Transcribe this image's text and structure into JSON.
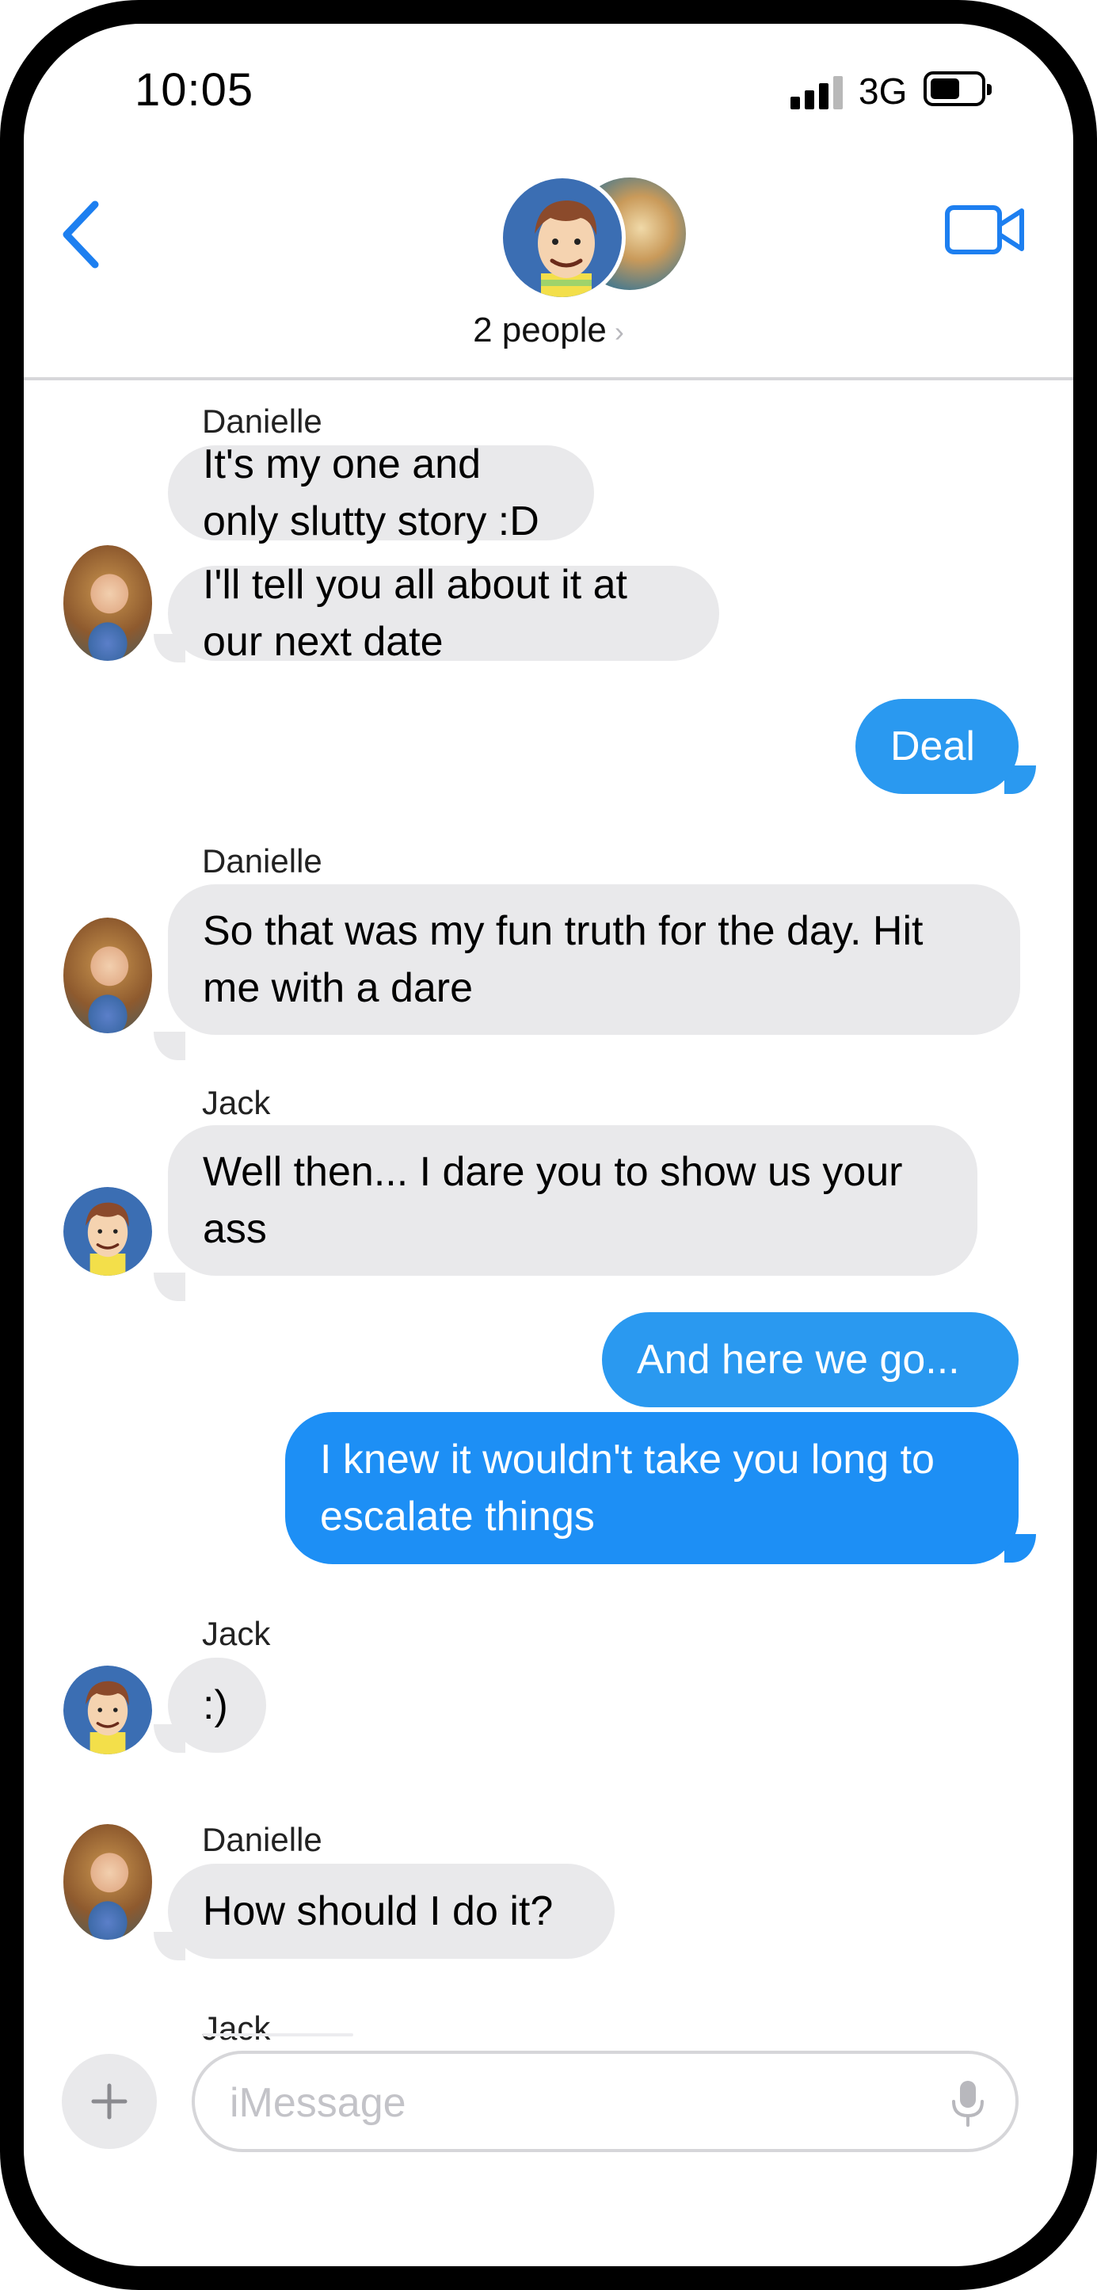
{
  "status_bar": {
    "time": "10:05",
    "network": "3G"
  },
  "header": {
    "people_label": "2 people",
    "people_chevron": "›"
  },
  "messages": [
    {
      "sender": "Danielle",
      "text": "It's my one and only slutty story :D"
    },
    {
      "text": "I'll tell you all about it at our next date"
    },
    {
      "text": "Deal"
    },
    {
      "sender": "Danielle",
      "line1": "So that was my fun truth for the day.  Hit",
      "line2": "me with a dare"
    },
    {
      "sender": "Jack",
      "line1": "Well then... I dare you to show us your",
      "line2": "ass"
    },
    {
      "text": "And here we go..."
    },
    {
      "line1": "I knew it wouldn't take you long to",
      "line2": "escalate things"
    },
    {
      "sender": "Jack",
      "text": ":)"
    },
    {
      "sender": "Danielle",
      "text": "How should I do it?"
    },
    {
      "sender": "Jack"
    }
  ],
  "composer": {
    "placeholder": "iMessage"
  },
  "colors": {
    "accent": "#1d8ff5",
    "incoming_bubble": "#e9e9eb",
    "jack_avatar_bg": "#3b6eb3"
  },
  "icons": [
    "back-chevron-icon",
    "video-camera-icon",
    "plus-icon",
    "microphone-icon",
    "signal-icon",
    "battery-icon"
  ]
}
